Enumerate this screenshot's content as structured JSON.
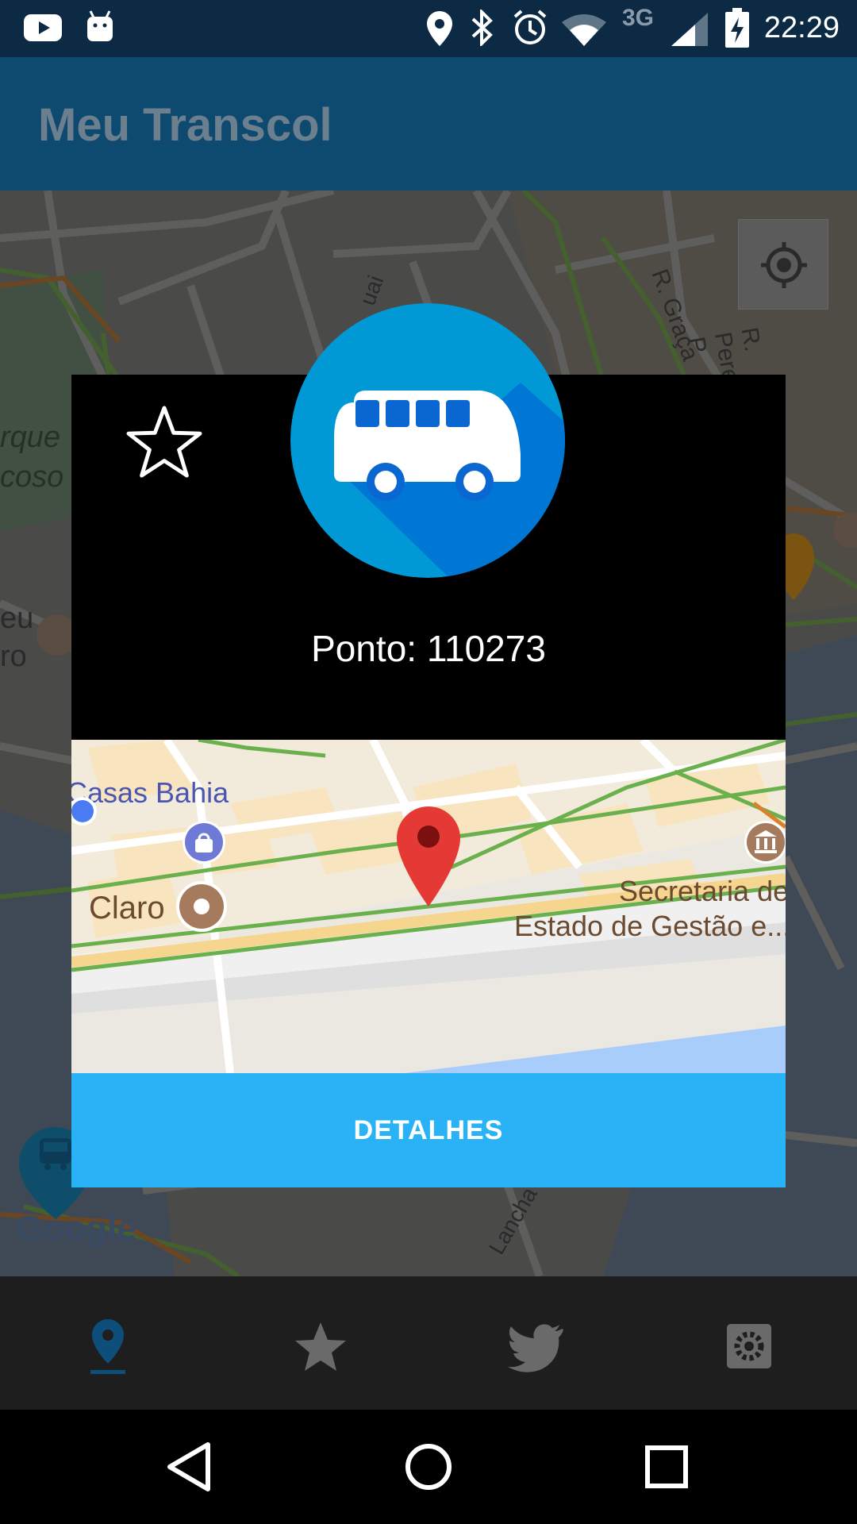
{
  "status_bar": {
    "time": "22:29",
    "network": "3G",
    "icons": [
      "youtube-icon",
      "android-icon",
      "location-icon",
      "bluetooth-icon",
      "alarm-icon",
      "wifi-icon",
      "signal-icon",
      "battery-charging-icon"
    ]
  },
  "app_bar": {
    "title": "Meu Transcol"
  },
  "map": {
    "street_labels": [
      "R. Graça",
      "R. Pereira P",
      "uai",
      "rque",
      "coso",
      "eu",
      "ro",
      "Lancha"
    ],
    "attribution": "Google"
  },
  "dialog": {
    "stop_label": "Ponto: 110273",
    "details_button": "DETALHES",
    "minimap_labels": {
      "casas_bahia": "Casas Bahia",
      "claro": "Claro",
      "secretaria_line1": "Secretaria de",
      "secretaria_line2": "Estado de Gestão e..."
    }
  },
  "bottom_nav": {
    "items": [
      "map-pin-icon",
      "star-icon",
      "twitter-icon",
      "settings-icon"
    ],
    "active_index": 0
  },
  "colors": {
    "app_bar": "#0e4a70",
    "accent": "#29b3f6",
    "bus_badge": "#0099d6",
    "marker": "#e53935"
  }
}
